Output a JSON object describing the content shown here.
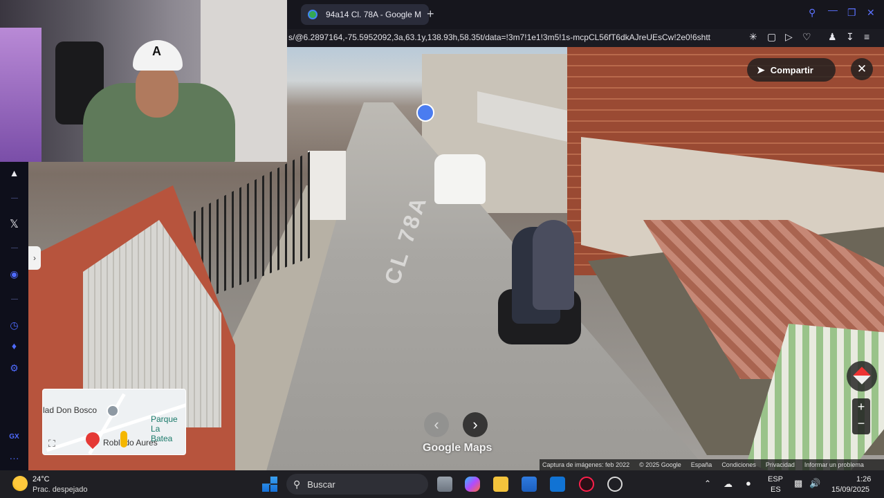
{
  "browser": {
    "tab_title": "94a14 Cl. 78A - Google M",
    "new_tab_glyph": "+",
    "url": "s/@6.2897164,-75.5952092,3a,63.1y,138.93h,58.35t/data=!3m7!1e1!3m5!1s-mcpCL56fT6dkAJreUEsCw!2e0!6shtt",
    "window_icons": [
      "search-icon",
      "minimize-icon",
      "maximize-icon",
      "close-icon"
    ],
    "address_icons": [
      "pin-icon",
      "snapshot-icon",
      "play-icon",
      "heart-icon",
      "profile-icon",
      "download-icon",
      "menu-icon"
    ]
  },
  "sidebar": {
    "items": [
      "aria-icon",
      "x-twitter-icon",
      "player-icon",
      "history-icon",
      "extensions-icon",
      "settings-icon",
      "gx-icon",
      "more-icon"
    ],
    "gx_label": "GX",
    "more_label": "···"
  },
  "maps": {
    "share_label": "Compartir",
    "road_marking": "CL 78A",
    "brand": "Google Maps",
    "footer": {
      "capture": "Captura de imágenes: feb 2022",
      "copyright": "© 2025 Google",
      "country": "España",
      "terms": "Condiciones",
      "privacy": "Privacidad",
      "report": "Informar un problema"
    },
    "minimap": {
      "label_top": "lad Don Bosco",
      "label_park": "Parque La Batea",
      "label_place": "Robledo Aures"
    }
  },
  "taskbar": {
    "temperature": "24°C",
    "weather": "Prac. despejado",
    "search_label": "Buscar",
    "language_top": "ESP",
    "language_bottom": "ES",
    "time": "1:26",
    "date": "15/09/2025"
  },
  "colors": {
    "accent": "#4f6bff",
    "taskbar_bg": "#1f1f24",
    "sidebar_bg": "#0e0f1b"
  }
}
